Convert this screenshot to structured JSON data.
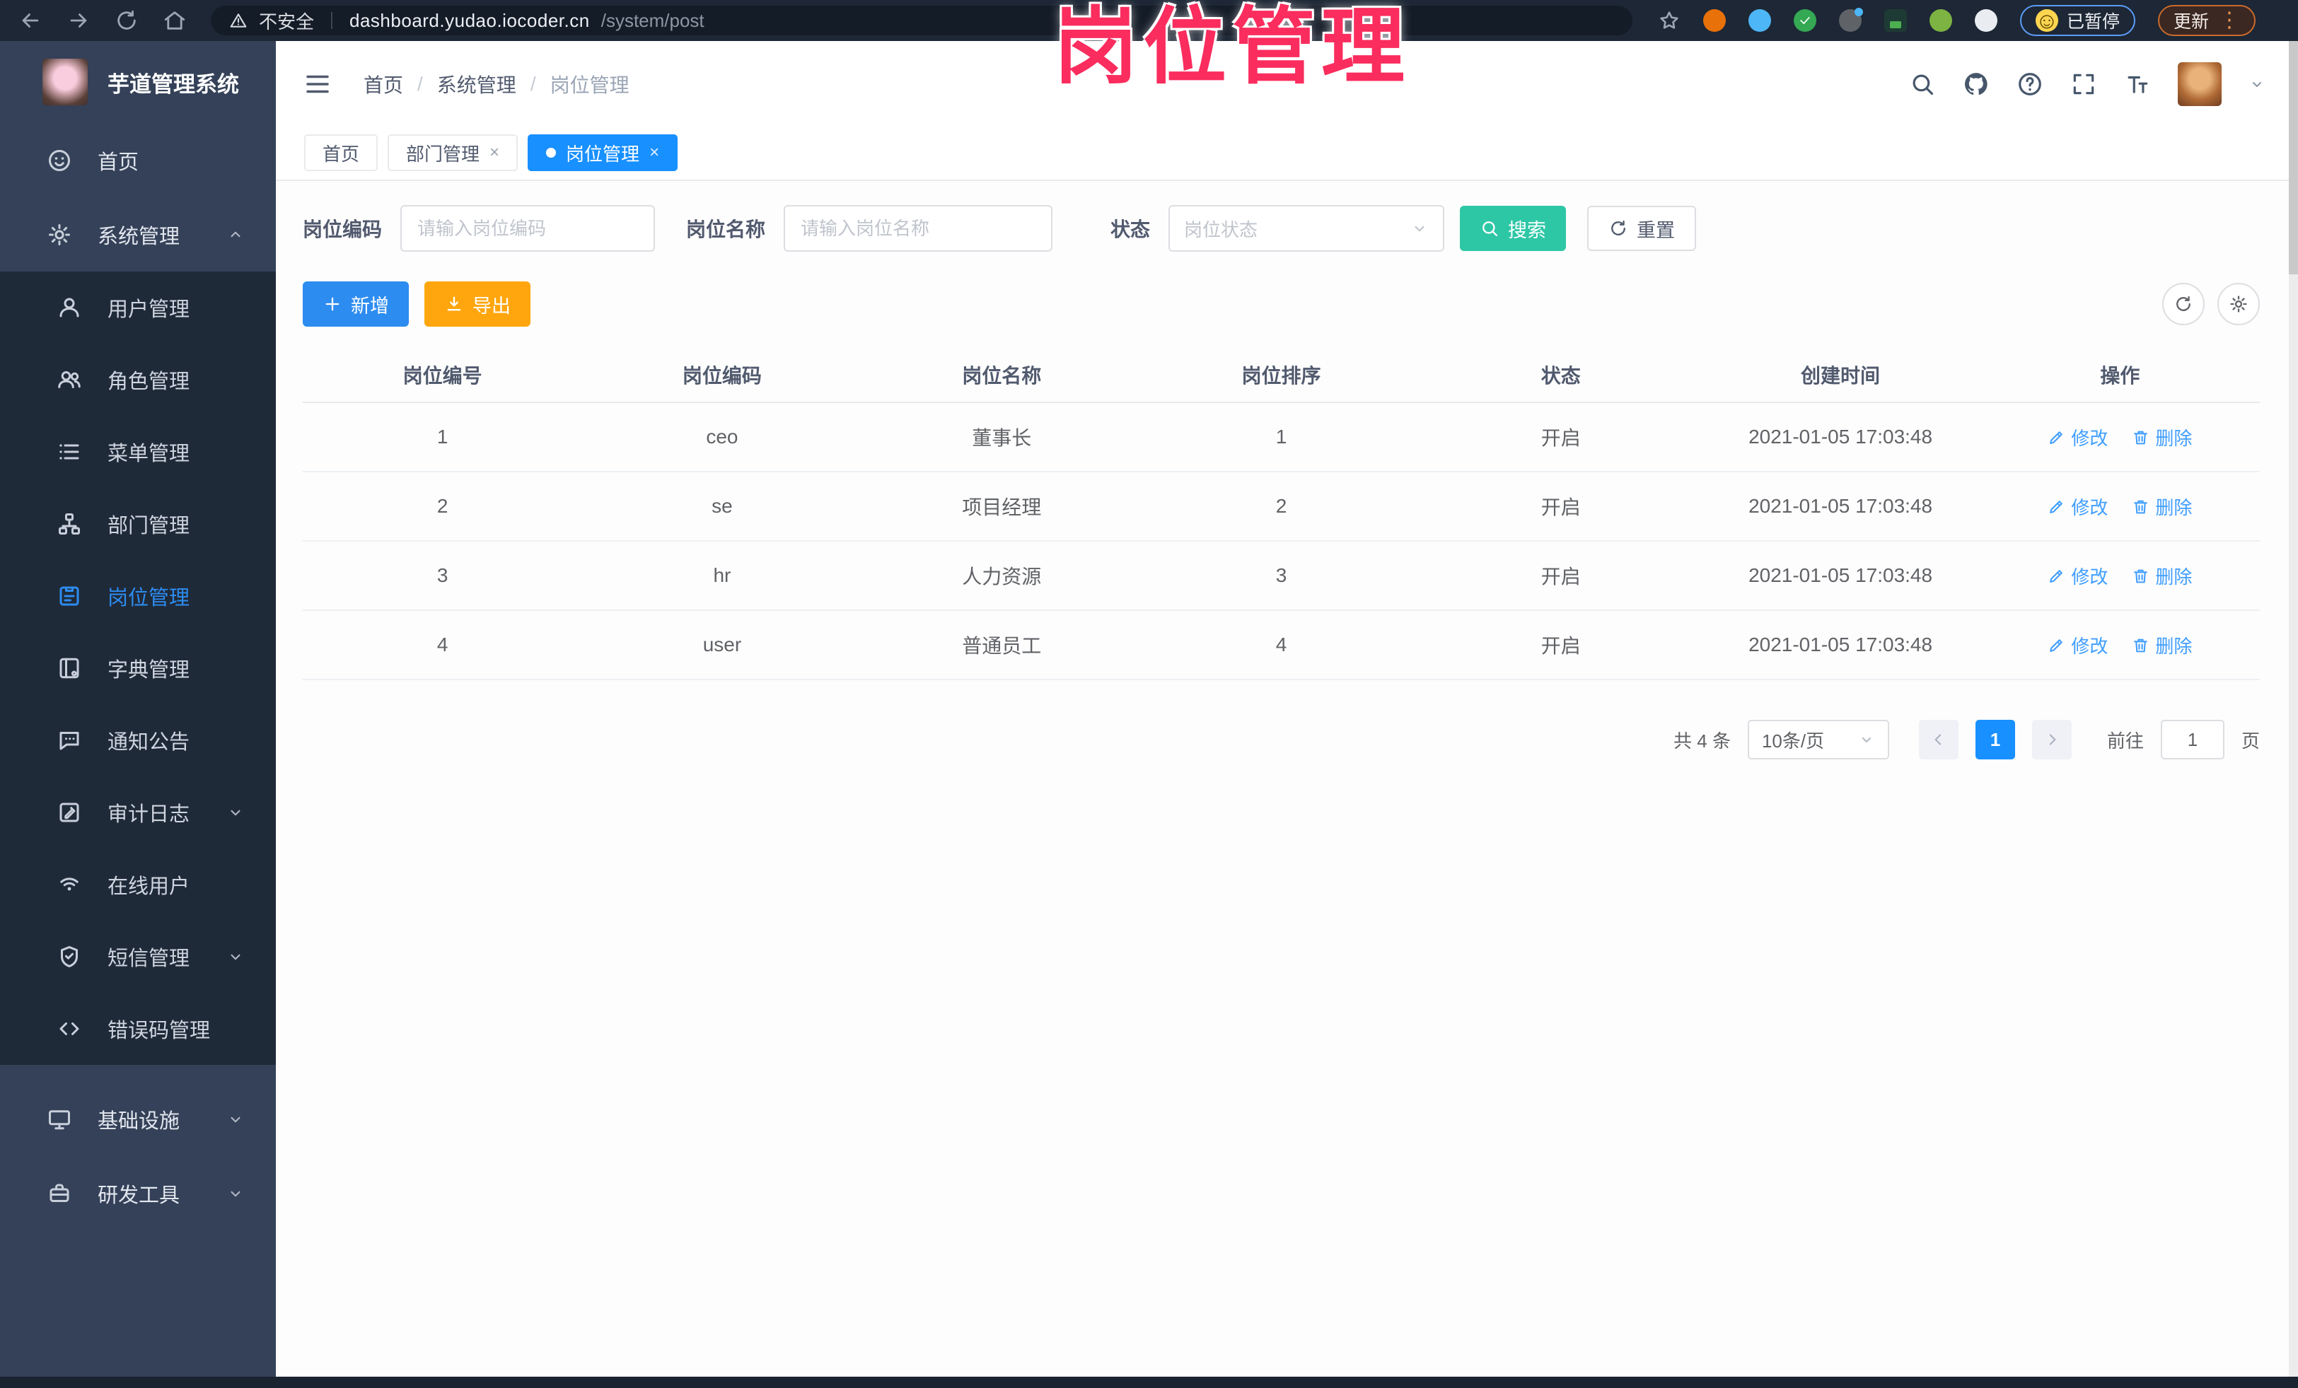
{
  "browser": {
    "security_label": "不安全",
    "url_host": "dashboard.yudao.iocoder.cn",
    "url_path": "/system/post",
    "paused_badge": "已暂停",
    "update_button": "更新"
  },
  "overlay": {
    "title": "岗位管理"
  },
  "colors": {
    "accent_blue": "#2d8cf0",
    "tab_active_blue": "#1890ff",
    "search_teal": "#2ec7a6",
    "export_orange": "#ffa60e",
    "overlay_pink": "#fa2d5e",
    "sidebar_navy": "#344158",
    "sidebar_submenu": "#1f2a39",
    "browser_bar": "#1d2735"
  },
  "icons": {
    "close": "×",
    "dots_vertical": "⋮",
    "breadcrumb_separator": "/"
  },
  "sidebar": {
    "app_title": "芋道管理系统",
    "items": [
      {
        "label": "首页"
      },
      {
        "label": "系统管理"
      },
      {
        "label": "用户管理"
      },
      {
        "label": "角色管理"
      },
      {
        "label": "菜单管理"
      },
      {
        "label": "部门管理"
      },
      {
        "label": "岗位管理",
        "active": true
      },
      {
        "label": "字典管理"
      },
      {
        "label": "通知公告"
      },
      {
        "label": "审计日志"
      },
      {
        "label": "在线用户"
      },
      {
        "label": "短信管理"
      },
      {
        "label": "错误码管理"
      },
      {
        "label": "基础设施"
      },
      {
        "label": "研发工具"
      }
    ]
  },
  "breadcrumb": {
    "items": [
      "首页",
      "系统管理",
      "岗位管理"
    ]
  },
  "tabs": [
    {
      "label": "首页"
    },
    {
      "label": "部门管理",
      "closable": true
    },
    {
      "label": "岗位管理",
      "closable": true,
      "active": true
    }
  ],
  "filters": {
    "code_label": "岗位编码",
    "code_placeholder": "请输入岗位编码",
    "name_label": "岗位名称",
    "name_placeholder": "请输入岗位名称",
    "status_label": "状态",
    "status_placeholder": "岗位状态",
    "search_label": "搜索",
    "reset_label": "重置"
  },
  "toolbar": {
    "add_label": "新增",
    "export_label": "导出"
  },
  "table": {
    "columns": [
      "岗位编号",
      "岗位编码",
      "岗位名称",
      "岗位排序",
      "状态",
      "创建时间",
      "操作"
    ],
    "edit_label": "修改",
    "delete_label": "删除",
    "rows": [
      {
        "id": "1",
        "code": "ceo",
        "name": "董事长",
        "sort": "1",
        "status": "开启",
        "created": "2021-01-05 17:03:48"
      },
      {
        "id": "2",
        "code": "se",
        "name": "项目经理",
        "sort": "2",
        "status": "开启",
        "created": "2021-01-05 17:03:48"
      },
      {
        "id": "3",
        "code": "hr",
        "name": "人力资源",
        "sort": "3",
        "status": "开启",
        "created": "2021-01-05 17:03:48"
      },
      {
        "id": "4",
        "code": "user",
        "name": "普通员工",
        "sort": "4",
        "status": "开启",
        "created": "2021-01-05 17:03:48"
      }
    ]
  },
  "pagination": {
    "total_text": "共 4 条",
    "page_size": "10条/页",
    "current_page": "1",
    "goto_label": "前往",
    "goto_value": "1",
    "page_unit": "页"
  }
}
